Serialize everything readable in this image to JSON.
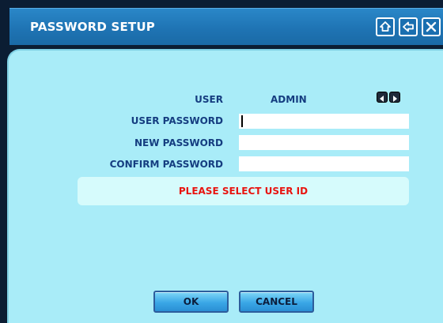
{
  "window": {
    "title": "PASSWORD SETUP"
  },
  "titlebar_buttons": [
    "home-icon",
    "back-arrow-icon",
    "close-icon"
  ],
  "form": {
    "user_label": "USER",
    "user_value": "ADMIN",
    "user_password_label": "USER PASSWORD",
    "user_password_value": "",
    "new_password_label": "NEW PASSWORD",
    "new_password_value": "",
    "confirm_password_label": "CONFIRM PASSWORD",
    "confirm_password_value": ""
  },
  "message": "PLEASE SELECT USER ID",
  "buttons": {
    "ok": "OK",
    "cancel": "CANCEL"
  },
  "colors": {
    "titlebar": "#1f74b4",
    "panel": "#a9ecf8",
    "label_text": "#153d80",
    "message_text": "#e8140f"
  }
}
